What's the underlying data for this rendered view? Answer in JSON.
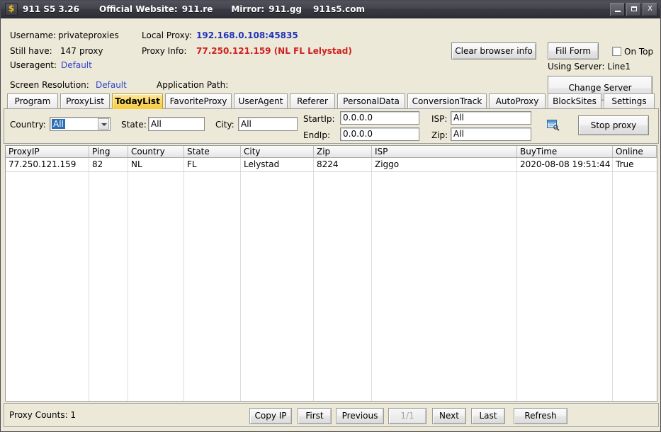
{
  "titlebar": {
    "icon": "dollar-icon",
    "app_name": "911 S5 3.26",
    "official_website_label": "Official Website:",
    "official_website": "911.re",
    "mirror_label": "Mirror:",
    "mirror": "911.gg",
    "mirror2": "911s5.com",
    "minimize": "–",
    "maximize": "□",
    "close": "X"
  },
  "info": {
    "username_label": "Username:",
    "username_value": "privateproxies",
    "still_have_label": "Still have:",
    "still_have_count": "147",
    "still_have_unit": "proxy",
    "useragent_label": "Useragent:",
    "useragent_value": "Default",
    "local_proxy_label": "Local Proxy:",
    "local_proxy_value": "192.168.0.108:45835",
    "proxy_info_label": "Proxy Info:",
    "proxy_info_value": "77.250.121.159 (NL FL Lelystad)",
    "screen_resolution_label": "Screen Resolution:",
    "screen_resolution_value": "Default",
    "application_path_label": "Application Path:",
    "application_path_value": "",
    "clear_browser_info": "Clear browser info",
    "fill_form": "Fill Form",
    "on_top": "On Top",
    "on_top_checked": false,
    "using_server": "Using Server: Line1",
    "change_server": "Change Server"
  },
  "tabs": [
    {
      "label": "Program",
      "active": false
    },
    {
      "label": "ProxyList",
      "active": false
    },
    {
      "label": "TodayList",
      "active": true
    },
    {
      "label": "FavoriteProxy",
      "active": false
    },
    {
      "label": "UserAgent",
      "active": false
    },
    {
      "label": "Referer",
      "active": false
    },
    {
      "label": "PersonalData",
      "active": false
    },
    {
      "label": "ConversionTrack",
      "active": false
    },
    {
      "label": "AutoProxy",
      "active": false
    },
    {
      "label": "BlockSites",
      "active": false
    },
    {
      "label": "Settings",
      "active": false
    }
  ],
  "filters": {
    "country_label": "Country:",
    "country_value": "All",
    "state_label": "State:",
    "state_value": "All",
    "city_label": "City:",
    "city_value": "All",
    "startip_label": "StartIp:",
    "startip_value": "0.0.0.0",
    "endip_label": "EndIp:",
    "endip_value": "0.0.0.0",
    "isp_label": "ISP:",
    "isp_value": "All",
    "zip_label": "Zip:",
    "zip_value": "All",
    "search_icon": "search-icon",
    "stop_proxy": "Stop proxy"
  },
  "table": {
    "columns": [
      "ProxyIP",
      "Ping",
      "Country",
      "State",
      "City",
      "Zip",
      "ISP",
      "BuyTime",
      "Online"
    ],
    "rows": [
      {
        "ProxyIP": "77.250.121.159",
        "Ping": "82",
        "Country": "NL",
        "State": "FL",
        "City": "Lelystad",
        "Zip": "8224",
        "ISP": "Ziggo",
        "BuyTime": "2020-08-08 19:51:44",
        "Online": "True"
      }
    ]
  },
  "bottom": {
    "proxy_counts": "Proxy Counts: 1",
    "copy_ip": "Copy IP",
    "first": "First",
    "previous": "Previous",
    "page_indicator": "1/1",
    "next": "Next",
    "last": "Last",
    "refresh": "Refresh"
  },
  "colors": {
    "accent_yellow": "#f8cc40",
    "link_blue": "#2233bb",
    "alert_red": "#d12020",
    "window_bg": "#ece9d8",
    "titlebar": "#3a3a44"
  }
}
